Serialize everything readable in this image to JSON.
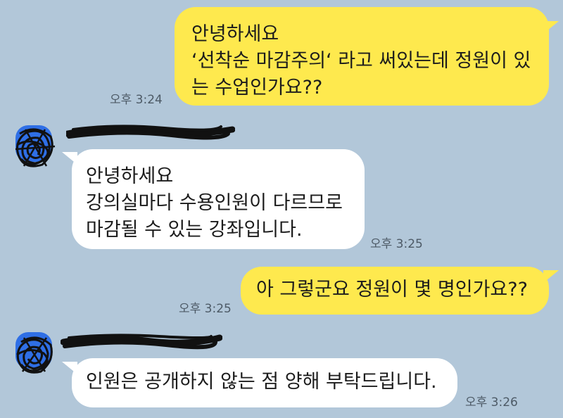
{
  "chat": {
    "messages": [
      {
        "sender": "me",
        "lines": [
          "안녕하세요",
          "‘선착순 마감주의‘ 라고 써있는데 정원이 있",
          "는 수업인가요??"
        ],
        "time": "오후 3:24"
      },
      {
        "sender": "them",
        "lines": [
          "안녕하세요",
          "강의실마다 수용인원이 다르므로",
          "마감될 수 있는 강좌입니다."
        ],
        "time": "오후 3:25"
      },
      {
        "sender": "me",
        "lines": [
          "아 그렇군요 정원이 몇 명인가요??"
        ],
        "time": "오후 3:25"
      },
      {
        "sender": "them",
        "lines": [
          "인원은 공개하지 않는 점 양해 부탁드립니다."
        ],
        "time": "오후 3:26"
      }
    ]
  },
  "colors": {
    "background": "#b2c7d9",
    "my_bubble": "#fee94e",
    "their_bubble": "#ffffff",
    "avatar_blue": "#2f6fe6"
  }
}
